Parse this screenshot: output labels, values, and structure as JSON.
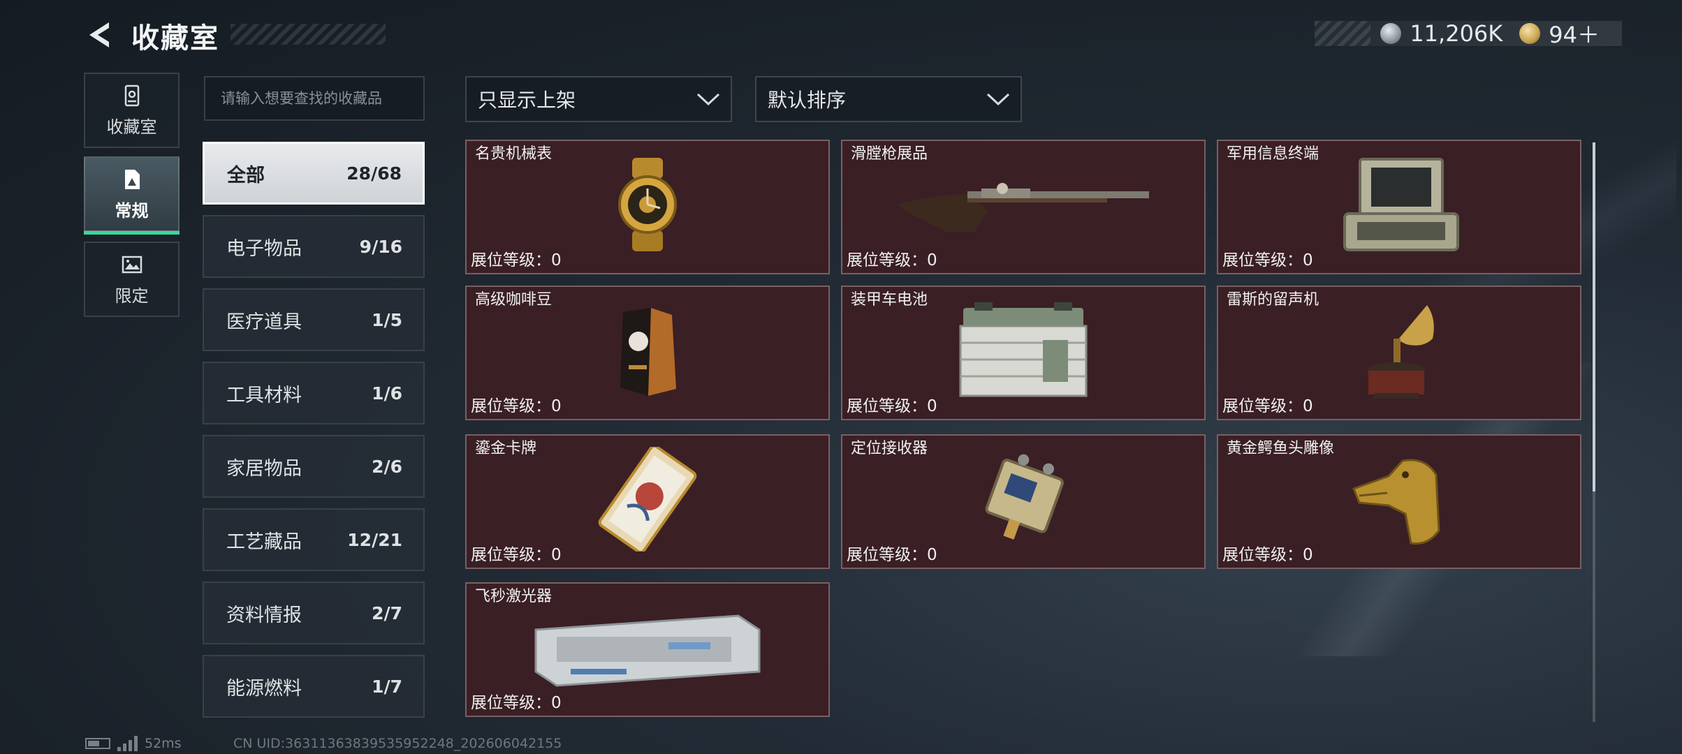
{
  "header": {
    "title": "收藏室",
    "currencies": [
      {
        "icon": "silver-coin-icon",
        "value": "11,206K"
      },
      {
        "icon": "gold-coin-icon",
        "value": "94＋"
      }
    ]
  },
  "left_tabs": [
    {
      "label": "收藏室",
      "icon": "vault-icon",
      "active": false
    },
    {
      "label": "常规",
      "icon": "document-icon",
      "active": true
    },
    {
      "label": "限定",
      "icon": "picture-icon",
      "active": false
    }
  ],
  "search": {
    "placeholder": "请输入想要查找的收藏品",
    "value": ""
  },
  "subcategories": [
    {
      "name": "全部",
      "count": "28/68",
      "active": true
    },
    {
      "name": "电子物品",
      "count": "9/16",
      "active": false
    },
    {
      "name": "医疗道具",
      "count": "1/5",
      "active": false
    },
    {
      "name": "工具材料",
      "count": "1/6",
      "active": false
    },
    {
      "name": "家居物品",
      "count": "2/6",
      "active": false
    },
    {
      "name": "工艺藏品",
      "count": "12/21",
      "active": false
    },
    {
      "name": "资料情报",
      "count": "2/7",
      "active": false
    },
    {
      "name": "能源燃料",
      "count": "1/7",
      "active": false
    }
  ],
  "filters": {
    "shelf": "只显示上架",
    "sort": "默认排序"
  },
  "level_label": "展位等级：",
  "items": [
    {
      "name": "名贵机械表",
      "level": "0",
      "icon": "gold-watch-icon"
    },
    {
      "name": "滑膛枪展品",
      "level": "0",
      "icon": "musket-icon"
    },
    {
      "name": "军用信息终端",
      "level": "0",
      "icon": "military-terminal-icon"
    },
    {
      "name": "高级咖啡豆",
      "level": "0",
      "icon": "coffee-bag-icon"
    },
    {
      "name": "装甲车电池",
      "level": "0",
      "icon": "vehicle-battery-icon"
    },
    {
      "name": "雷斯的留声机",
      "level": "0",
      "icon": "gramophone-icon"
    },
    {
      "name": "鎏金卡牌",
      "level": "0",
      "icon": "gilded-card-icon"
    },
    {
      "name": "定位接收器",
      "level": "0",
      "icon": "gps-receiver-icon"
    },
    {
      "name": "黄金鳄鱼头雕像",
      "level": "0",
      "icon": "gold-crocodile-statue-icon"
    },
    {
      "name": "飞秒激光器",
      "level": "0",
      "icon": "femtosecond-laser-icon"
    }
  ],
  "footer": {
    "ping": "52ms",
    "uid": "CN UID:36311363839535952248_202606042155"
  },
  "colors": {
    "card_bg": "#3a1f25",
    "card_border": "#7b5f63",
    "accent_green": "#3bd79b",
    "page_bg": "#1a2129"
  }
}
